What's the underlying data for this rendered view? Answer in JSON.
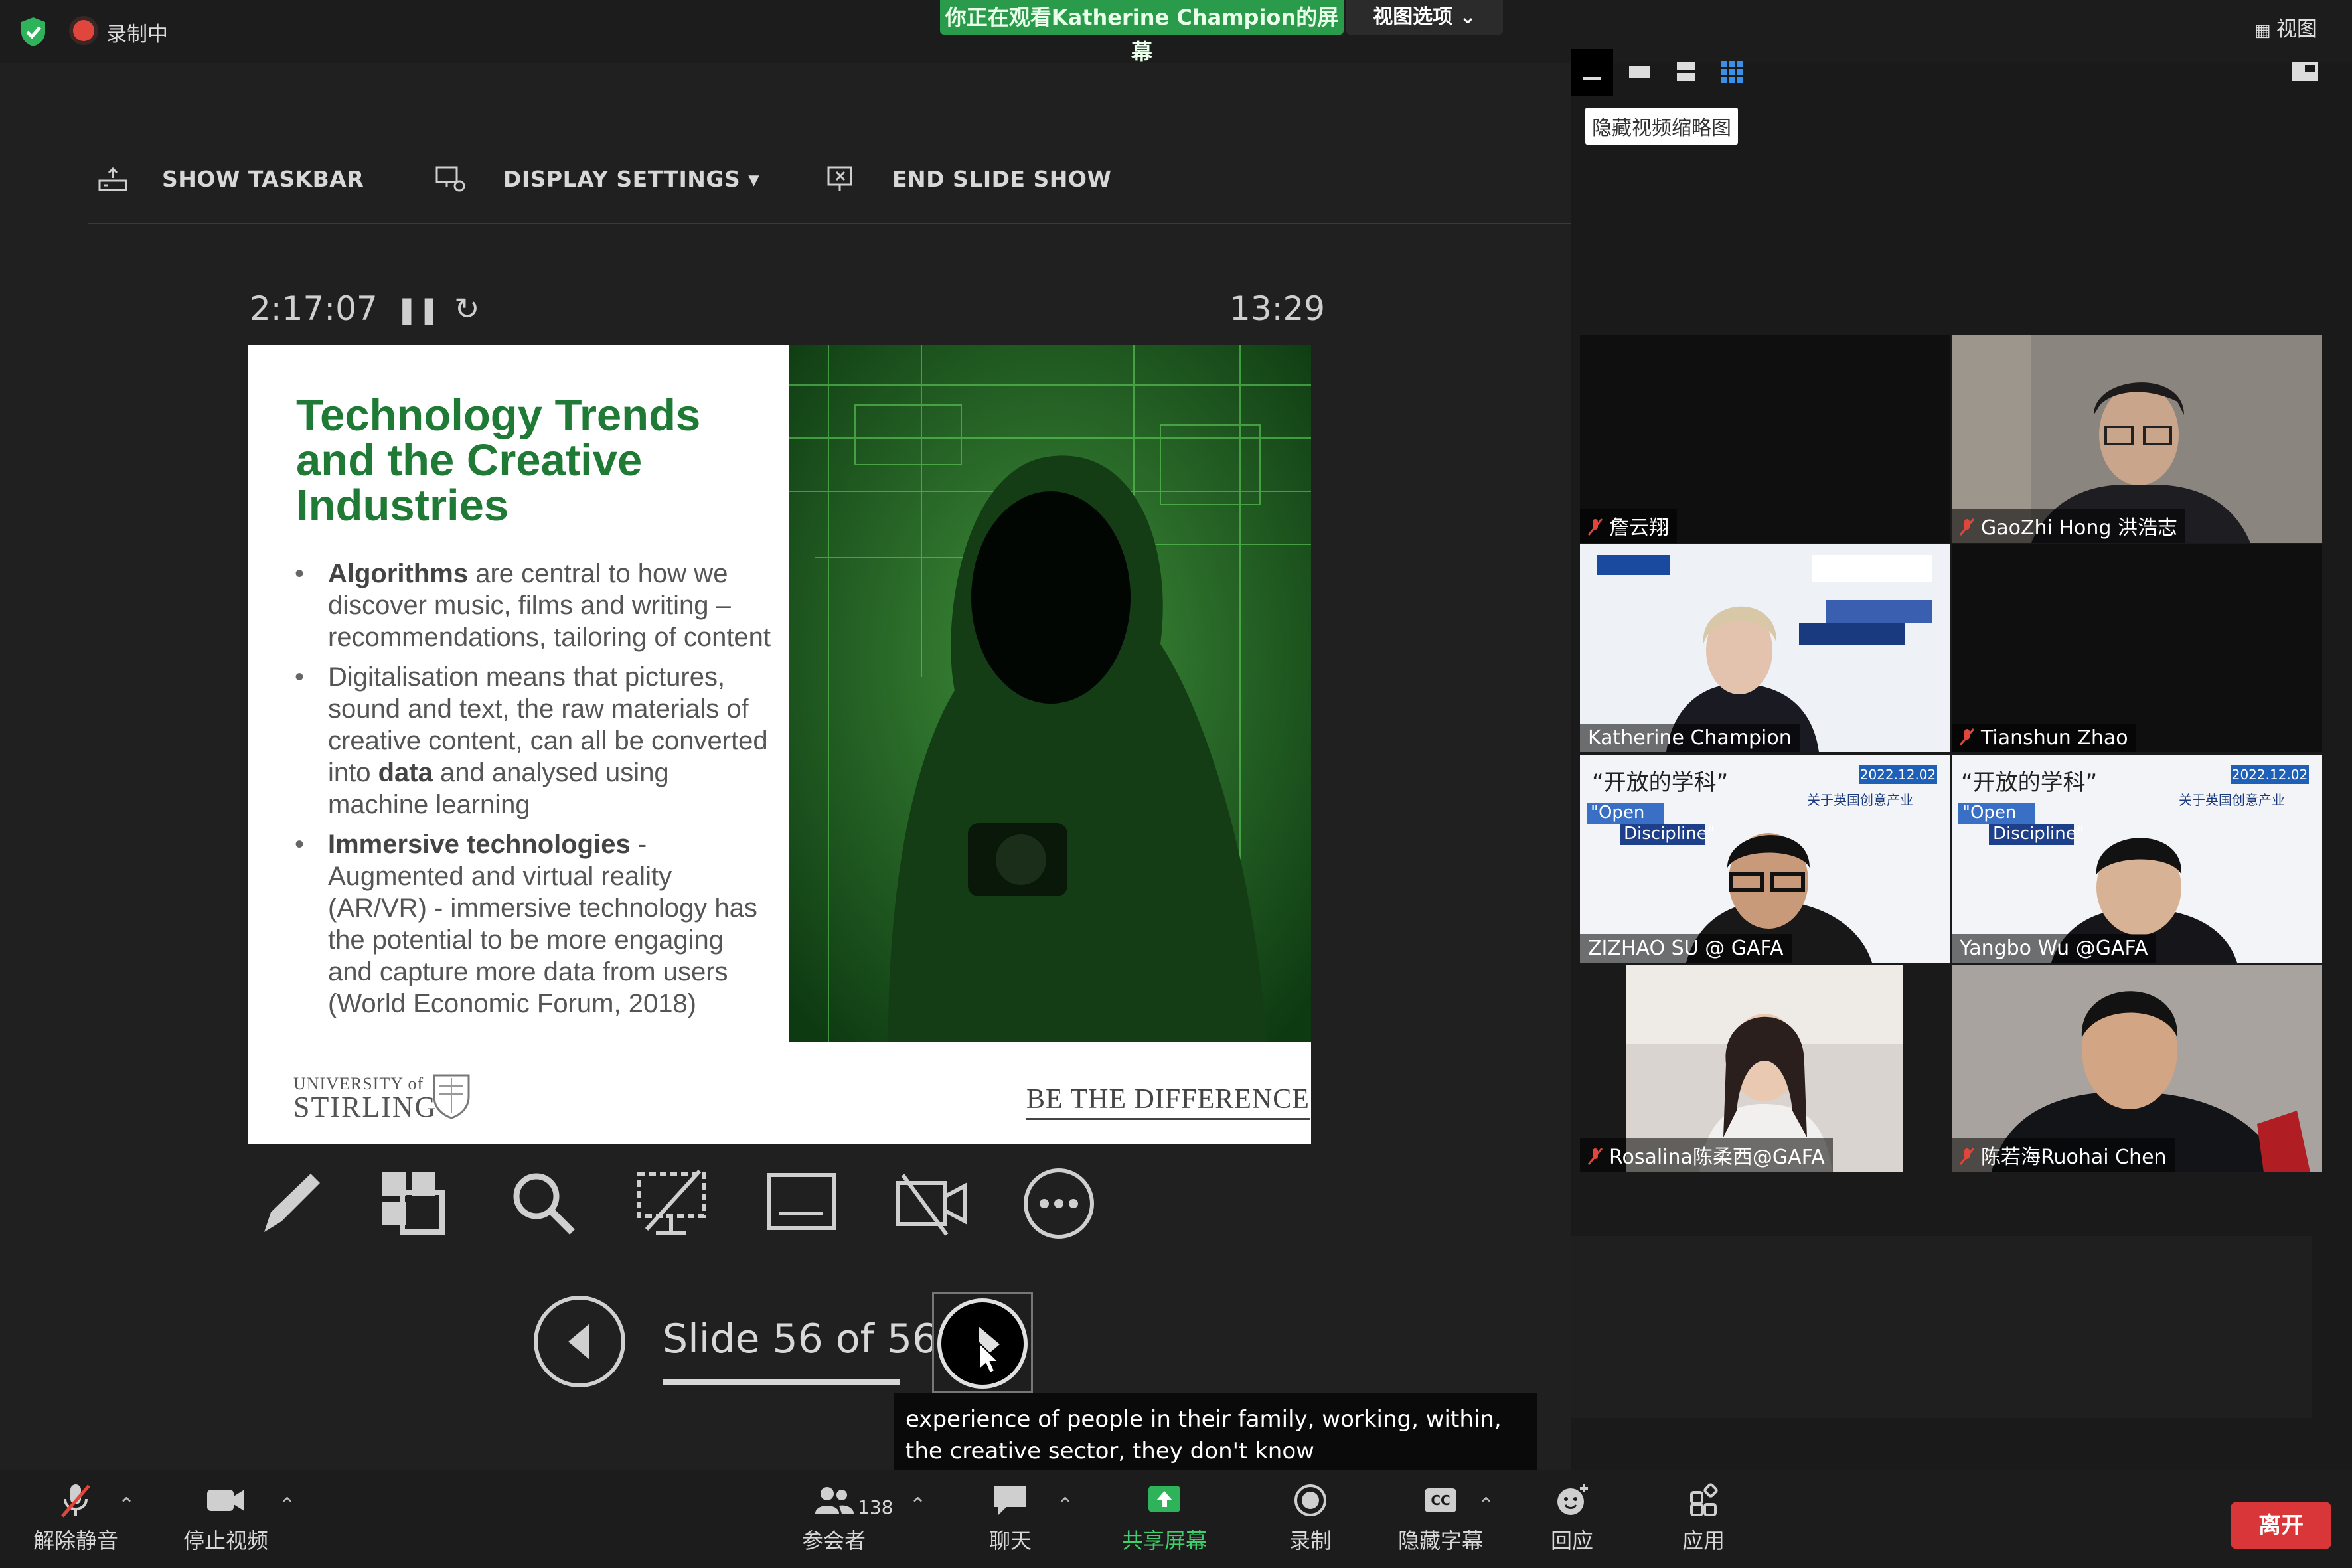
{
  "top_bar": {
    "recording_label": "录制中",
    "viewing_banner": "你正在观看Katherine  Champion的屏幕",
    "view_options": "视图选项 ⌄",
    "view_button": "视图"
  },
  "presenter": {
    "toolbar": {
      "show_taskbar": "SHOW TASKBAR",
      "display_settings": "DISPLAY SETTINGS ▾",
      "end_slide_show": "END SLIDE SHOW"
    },
    "elapsed": "2:17:07",
    "clock": "13:29",
    "slide": {
      "title": "Technology Trends and the Creative Industries",
      "bullets": [
        {
          "bold": "Algorithms",
          "text": " are central to how we discover music, films and writing – recommendations, tailoring of content"
        },
        {
          "pre": "Digitalisation means that pictures, sound and text, the raw materials of creative content, can all be converted into ",
          "bold": "data",
          "post": " and analysed using machine learning"
        },
        {
          "bold": "Immersive technologies",
          "text": " - Augmented and virtual reality (AR/VR) - immersive technology has the potential to be more engaging and capture more data from users (World Economic Forum, 2018)"
        }
      ],
      "logo_university": "UNIVERSITY of",
      "logo_name": "STIRLING",
      "tagline": "BE THE DIFFERENCE"
    },
    "slide_counter": "Slide 56 of 56",
    "caption": "experience of people in their family, working, within, the creative sector, they don't know"
  },
  "gallery": {
    "hide_thumbnails": "隐藏视频缩略图",
    "tiles": [
      {
        "name": "詹云翔",
        "muted": true
      },
      {
        "name": "GaoZhi Hong 洪浩志",
        "muted": true
      },
      {
        "name": "Katherine Champion",
        "muted": false
      },
      {
        "name": "Tianshun Zhao",
        "muted": true
      },
      {
        "name": "ZIZHAO SU @ GAFA",
        "muted": false
      },
      {
        "name": "Yangbo Wu @GAFA",
        "muted": false
      },
      {
        "name": "Rosalina陈柔西@GAFA",
        "muted": true
      },
      {
        "name": "陈若海Ruohai Chen",
        "muted": true
      }
    ],
    "poster": {
      "cn_title": "“开放的学科”",
      "en_title_1": "\"Open",
      "en_title_2": "Discipline\"",
      "date": "2022.12.02",
      "subtitle": "关于英国创意产业"
    }
  },
  "bottom_bar": {
    "unmute": "解除静音",
    "stop_video": "停止视频",
    "participants": "参会者",
    "participant_count": "138",
    "chat": "聊天",
    "share_screen": "共享屏幕",
    "record": "录制",
    "captions": "隐藏字幕",
    "reactions": "回应",
    "apps": "应用",
    "leave": "离开"
  },
  "colors": {
    "accent_green": "#2a9b4b",
    "slide_title_green": "#1e7a34",
    "leave_red": "#d9363a",
    "active_speaker": "#c7e87a"
  }
}
